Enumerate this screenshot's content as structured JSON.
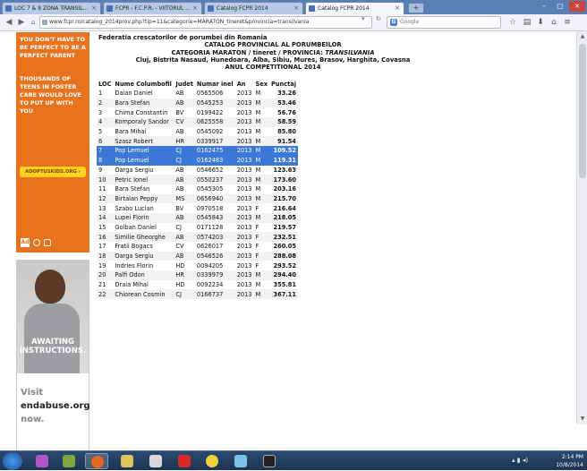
{
  "browser": {
    "tabs": [
      {
        "label": "LOC 7 & 8 ZONA TRANSIL..."
      },
      {
        "label": "FCPR - F.C.P.R. - VIITORUL ..."
      },
      {
        "label": "Catalog FCPR 2014"
      },
      {
        "label": "Catalog FCPR 2014"
      }
    ],
    "new_tab": "+",
    "url": "www.fcpr.ro/catalog_2014prov.php?tip=11&categorie=MARATON_tineret&provincia=transilvania",
    "search_placeholder": "Google",
    "search_engine_letter": "G"
  },
  "ads": {
    "ad1": {
      "headline": "YOU DON'T HAVE TO BE PERFECT TO BE A PERFECT PARENT",
      "body": "THOUSANDS OF TEENS IN FOSTER CARE WOULD LOVE TO PUT UP WITH YOU",
      "button": "ADOPTUSKIDS.ORG ›",
      "logo": "Ad"
    },
    "ad2": {
      "shirt": "AWAITING INSTRUCTIONS.",
      "visit": "Visit",
      "url": "endabuse.org",
      "now": "now."
    }
  },
  "page": {
    "line1": "Federatia crescatorilor de porumbei din Romania",
    "line2": "CATALOG PROVINCIAL AL PORUMBEILOR",
    "line3_prefix": "CATEGORIA MARATON / tineret / PROVINCIA: ",
    "line3_province": "TRANSILVANIA",
    "line4": "Cluj, Bistrita Nasaud, Hunedoara, Alba, Sibiu, Mures, Brasov, Harghita, Covasna",
    "line5": "ANUL COMPETITIONAL 2014"
  },
  "table": {
    "headers": [
      "LOC",
      "Nume Columbofil",
      "Judet",
      "Numar inel",
      "An",
      "Sex",
      "Punctaj"
    ],
    "rows": [
      {
        "loc": "1",
        "name": "Daian Daniel",
        "judet": "AB",
        "inel": "0565506",
        "an": "2013",
        "sex": "M",
        "punctaj": "33.26"
      },
      {
        "loc": "2",
        "name": "Bara Stefan",
        "judet": "AB",
        "inel": "0545253",
        "an": "2013",
        "sex": "M",
        "punctaj": "53.46"
      },
      {
        "loc": "3",
        "name": "Chima Constantin",
        "judet": "BV",
        "inel": "0199422",
        "an": "2013",
        "sex": "M",
        "punctaj": "56.76"
      },
      {
        "loc": "4",
        "name": "Komporaly Sandor",
        "judet": "CV",
        "inel": "0625558",
        "an": "2013",
        "sex": "M",
        "punctaj": "58.59"
      },
      {
        "loc": "5",
        "name": "Bara Mihai",
        "judet": "AB",
        "inel": "0545092",
        "an": "2013",
        "sex": "M",
        "punctaj": "85.80"
      },
      {
        "loc": "6",
        "name": "Szasz Robert",
        "judet": "HR",
        "inel": "0339917",
        "an": "2013",
        "sex": "M",
        "punctaj": "91.54"
      },
      {
        "loc": "7",
        "name": "Pop Lemuel",
        "judet": "CJ",
        "inel": "0162475",
        "an": "2013",
        "sex": "M",
        "punctaj": "109.52",
        "selected": true
      },
      {
        "loc": "8",
        "name": "Pop Lemuel",
        "judet": "CJ",
        "inel": "0162483",
        "an": "2013",
        "sex": "M",
        "punctaj": "119.31",
        "selected": true
      },
      {
        "loc": "9",
        "name": "Oarga Sergiu",
        "judet": "AB",
        "inel": "0546652",
        "an": "2013",
        "sex": "M",
        "punctaj": "123.63"
      },
      {
        "loc": "10",
        "name": "Petric Ionel",
        "judet": "AB",
        "inel": "0550237",
        "an": "2013",
        "sex": "M",
        "punctaj": "173.60"
      },
      {
        "loc": "11",
        "name": "Bara Stefan",
        "judet": "AB",
        "inel": "0545305",
        "an": "2013",
        "sex": "M",
        "punctaj": "203.16"
      },
      {
        "loc": "12",
        "name": "Birtalan Peppy",
        "judet": "MS",
        "inel": "0656940",
        "an": "2013",
        "sex": "M",
        "punctaj": "215.70"
      },
      {
        "loc": "13",
        "name": "Szabo Lucian",
        "judet": "BV",
        "inel": "0970518",
        "an": "2013",
        "sex": "F",
        "punctaj": "216.64"
      },
      {
        "loc": "14",
        "name": "Lupei Florin",
        "judet": "AB",
        "inel": "0545843",
        "an": "2013",
        "sex": "M",
        "punctaj": "218.05"
      },
      {
        "loc": "15",
        "name": "Golban Daniel",
        "judet": "CJ",
        "inel": "0171128",
        "an": "2013",
        "sex": "F",
        "punctaj": "219.57"
      },
      {
        "loc": "16",
        "name": "Similie Gheorghe",
        "judet": "AB",
        "inel": "0574203",
        "an": "2013",
        "sex": "F",
        "punctaj": "232.51"
      },
      {
        "loc": "17",
        "name": "Fratii Bogacs",
        "judet": "CV",
        "inel": "0626017",
        "an": "2013",
        "sex": "F",
        "punctaj": "260.05"
      },
      {
        "loc": "18",
        "name": "Oarga Sergiu",
        "judet": "AB",
        "inel": "0546526",
        "an": "2013",
        "sex": "F",
        "punctaj": "288.08"
      },
      {
        "loc": "19",
        "name": "Indries Florin",
        "judet": "HD",
        "inel": "0094205",
        "an": "2013",
        "sex": "F",
        "punctaj": "293.52"
      },
      {
        "loc": "20",
        "name": "Palfi Odon",
        "judet": "HR",
        "inel": "0339979",
        "an": "2013",
        "sex": "M",
        "punctaj": "294.40"
      },
      {
        "loc": "21",
        "name": "Draia Mihai",
        "judet": "HD",
        "inel": "0092234",
        "an": "2013",
        "sex": "M",
        "punctaj": "355.81"
      },
      {
        "loc": "22",
        "name": "Chiorean Cosmin",
        "judet": "CJ",
        "inel": "0166737",
        "an": "2013",
        "sex": "M",
        "punctaj": "367.11"
      }
    ]
  },
  "taskbar": {
    "time": "2:14 PM",
    "date": "10/8/2014"
  },
  "colors": {
    "tabstrip": "#5a7fb4",
    "ad_orange": "#e8731f",
    "ad_button": "#ffd21f",
    "selection": "#3b78d8",
    "taskbar": "#1c3553"
  }
}
